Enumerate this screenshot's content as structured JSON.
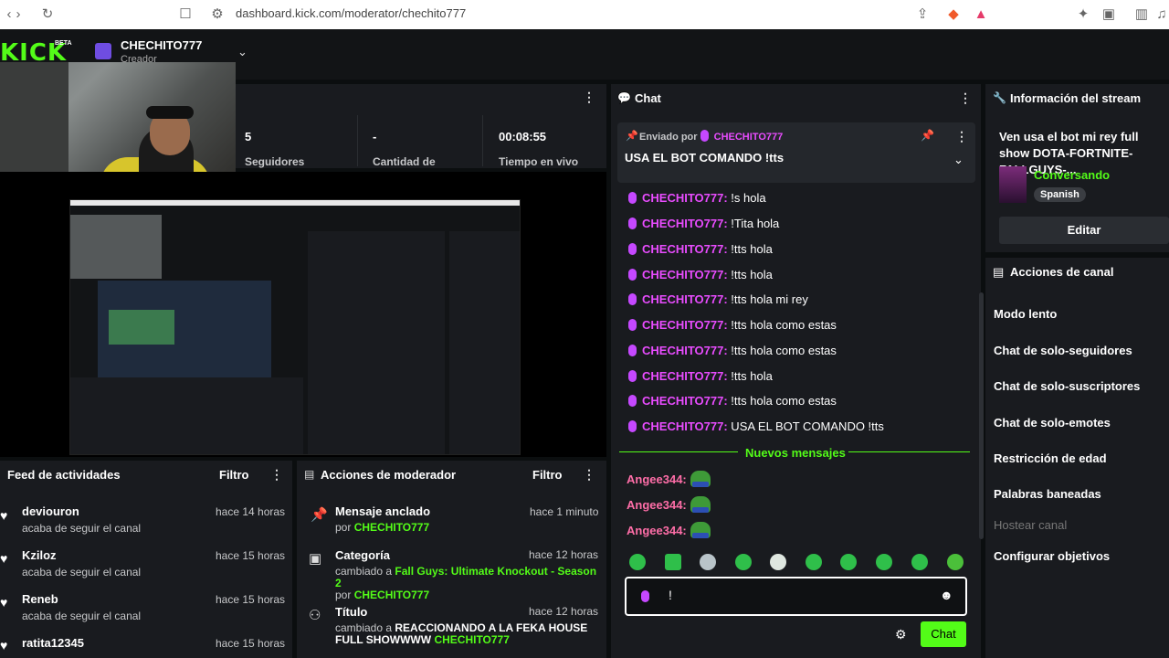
{
  "browser": {
    "url": "dashboard.kick.com/moderator/chechito777"
  },
  "header": {
    "logo": "KICK",
    "beta": "BETA",
    "channel_name": "CHECHITO777",
    "channel_role": "Creador"
  },
  "stats": [
    {
      "value": "5",
      "label": "Seguidores"
    },
    {
      "value": "-",
      "label": "Cantidad de"
    },
    {
      "value": "00:08:55",
      "label": "Tiempo en vivo"
    }
  ],
  "activity_feed": {
    "title": "Feed de actividades",
    "filter_label": "Filtro",
    "items": [
      {
        "name": "deviouron",
        "action": "acaba de seguir el canal",
        "time": "hace 14 horas"
      },
      {
        "name": "Kziloz",
        "action": "acaba de seguir el canal",
        "time": "hace 15 horas"
      },
      {
        "name": "Reneb",
        "action": "acaba de seguir el canal",
        "time": "hace 15 horas"
      },
      {
        "name": "ratita12345",
        "action": "",
        "time": "hace 15 horas"
      }
    ]
  },
  "mod_actions": {
    "title": "Acciones de moderador",
    "filter_label": "Filtro",
    "items": [
      {
        "title": "Mensaje anclado",
        "prefix": "por",
        "detail": "",
        "by": "CHECHITO777",
        "time": "hace 1 minuto"
      },
      {
        "title": "Categoría",
        "prefix": "cambiado a",
        "detail": "Fall Guys: Ultimate Knockout - Season 2",
        "by_prefix": "por",
        "by": "CHECHITO777",
        "time": "hace 12 horas"
      },
      {
        "title": "Título",
        "prefix": "cambiado a",
        "detail": "REACCIONANDO A LA FEKA HOUSE FULL SHOWWWW",
        "by_prefix": "por",
        "by": "CHECHITO777",
        "time": "hace 12 horas"
      }
    ]
  },
  "chat": {
    "title": "Chat",
    "pinned_prefix": "Enviado por",
    "pinned_user": "CHECHITO777",
    "pinned_message": "USA EL BOT COMANDO !tts",
    "new_messages_label": "Nuevos mensajes",
    "send_label": "Chat",
    "input_value": "!",
    "messages": [
      {
        "user": "CHECHITO777:",
        "text": " !s hola"
      },
      {
        "user": "CHECHITO777:",
        "text": " !Tita hola"
      },
      {
        "user": "CHECHITO777:",
        "text": " !tts hola"
      },
      {
        "user": "CHECHITO777:",
        "text": " !tts hola"
      },
      {
        "user": "CHECHITO777:",
        "text": " !tts hola mi rey"
      },
      {
        "user": "CHECHITO777:",
        "text": " !tts hola como estas"
      },
      {
        "user": "CHECHITO777:",
        "text": " !tts hola como estas"
      },
      {
        "user": "CHECHITO777:",
        "text": " !tts hola"
      },
      {
        "user": "CHECHITO777:",
        "text": " !tts hola como estas"
      },
      {
        "user": "CHECHITO777:",
        "text": " USA EL BOT COMANDO !tts"
      }
    ],
    "new_messages": [
      {
        "user": "Angee344:"
      },
      {
        "user": "Angee344:"
      },
      {
        "user": "Angee344:"
      }
    ]
  },
  "stream_info": {
    "title": "Información del stream",
    "stream_title": "Ven usa el bot mi rey full show DOTA-FORTNITE-FALLGUYS-...",
    "category": "Conversando",
    "language": "Spanish",
    "edit_label": "Editar"
  },
  "channel_actions": {
    "title": "Acciones de canal",
    "items": [
      "Modo lento",
      "Chat de solo-seguidores",
      "Chat de solo-suscriptores",
      "Chat de solo-emotes",
      "Restricción de edad",
      "Palabras baneadas",
      "Hostear canal",
      "Configurar objetivos"
    ]
  }
}
